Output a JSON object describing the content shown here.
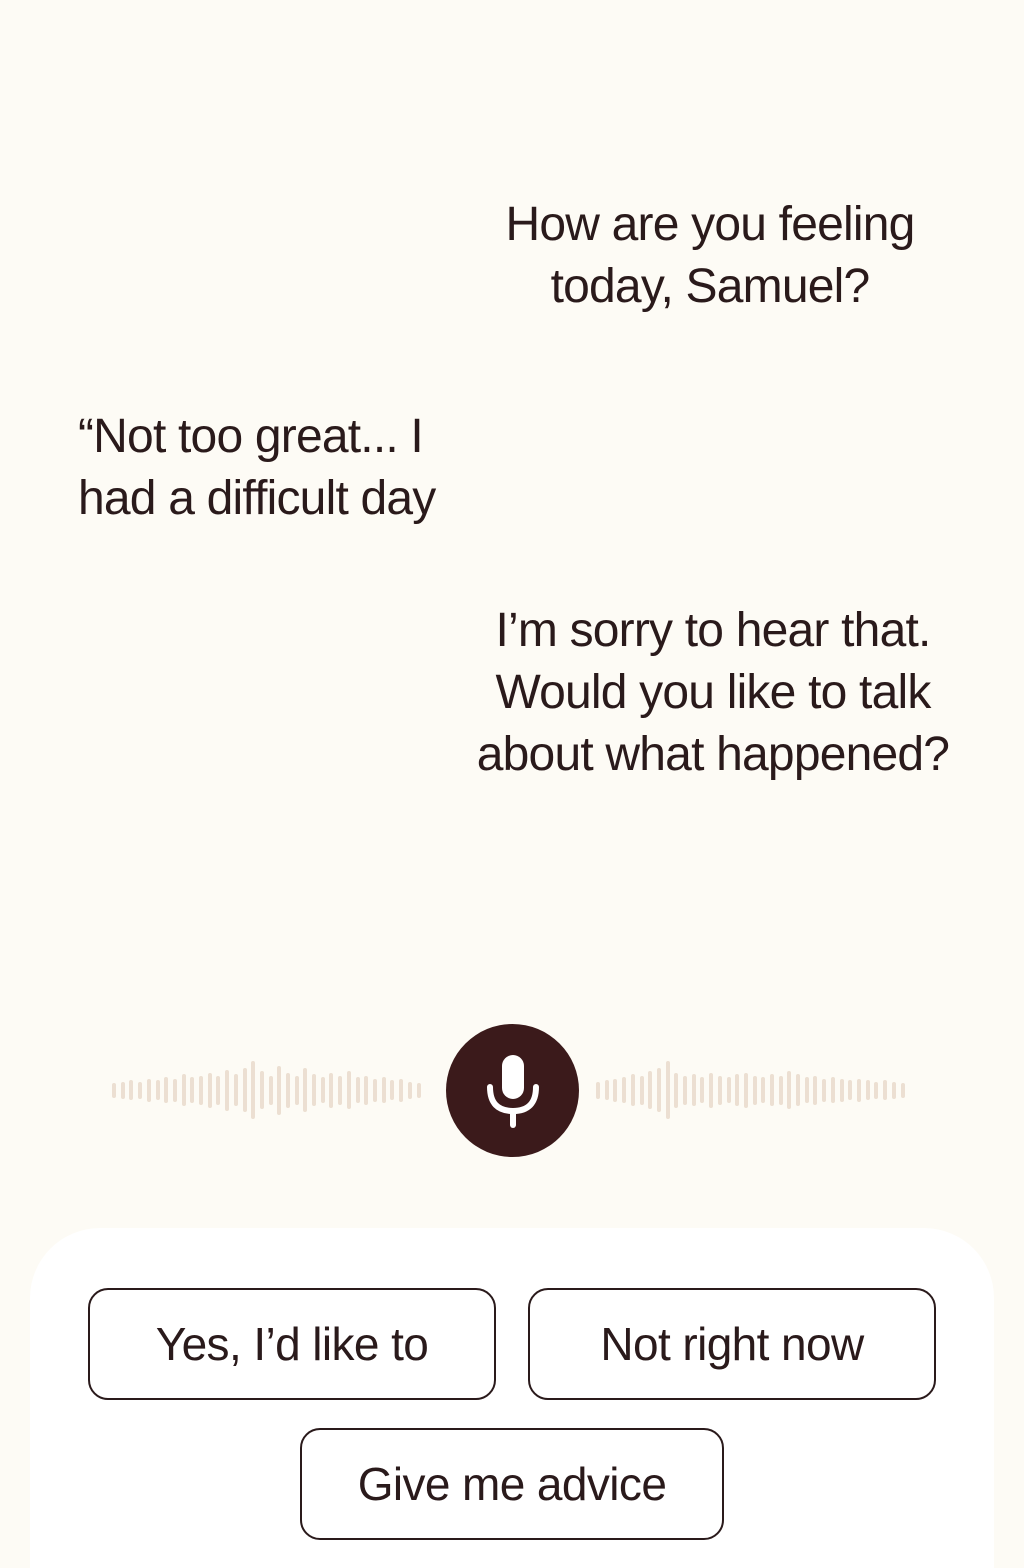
{
  "conversation": {
    "messages": [
      {
        "sender": "assistant",
        "lines": [
          "How are you feeling",
          "today, Samuel?"
        ]
      },
      {
        "sender": "user",
        "lines": [
          "“Not too great... I",
          "had a difficult day"
        ]
      },
      {
        "sender": "assistant",
        "lines": [
          "I’m sorry to hear that.",
          "Would you like to talk",
          "about what happened?"
        ]
      }
    ]
  },
  "voice_input": {
    "mic_icon": "microphone-icon",
    "waveform_color": "#ecdfd2",
    "left_levels": [
      0.25,
      0.3,
      0.35,
      0.3,
      0.4,
      0.35,
      0.45,
      0.4,
      0.55,
      0.45,
      0.5,
      0.6,
      0.5,
      0.7,
      0.55,
      0.75,
      1.0,
      0.65,
      0.5,
      0.85,
      0.6,
      0.5,
      0.75,
      0.55,
      0.45,
      0.6,
      0.5,
      0.65,
      0.45,
      0.5,
      0.4,
      0.45,
      0.35,
      0.4,
      0.3,
      0.25
    ],
    "right_levels": [
      0.3,
      0.35,
      0.4,
      0.45,
      0.55,
      0.5,
      0.65,
      0.75,
      1.0,
      0.6,
      0.5,
      0.55,
      0.45,
      0.6,
      0.5,
      0.45,
      0.55,
      0.6,
      0.5,
      0.45,
      0.55,
      0.5,
      0.65,
      0.55,
      0.45,
      0.5,
      0.4,
      0.45,
      0.4,
      0.35,
      0.4,
      0.35,
      0.3,
      0.35,
      0.3,
      0.25
    ]
  },
  "quick_replies": {
    "yes_label": "Yes, I’d like to",
    "not_now_label": "Not right now",
    "advice_label": "Give me advice"
  },
  "colors": {
    "background": "#fdfbf5",
    "text": "#2a1a1b",
    "accent": "#3b1a1b",
    "sheet": "#ffffff"
  }
}
